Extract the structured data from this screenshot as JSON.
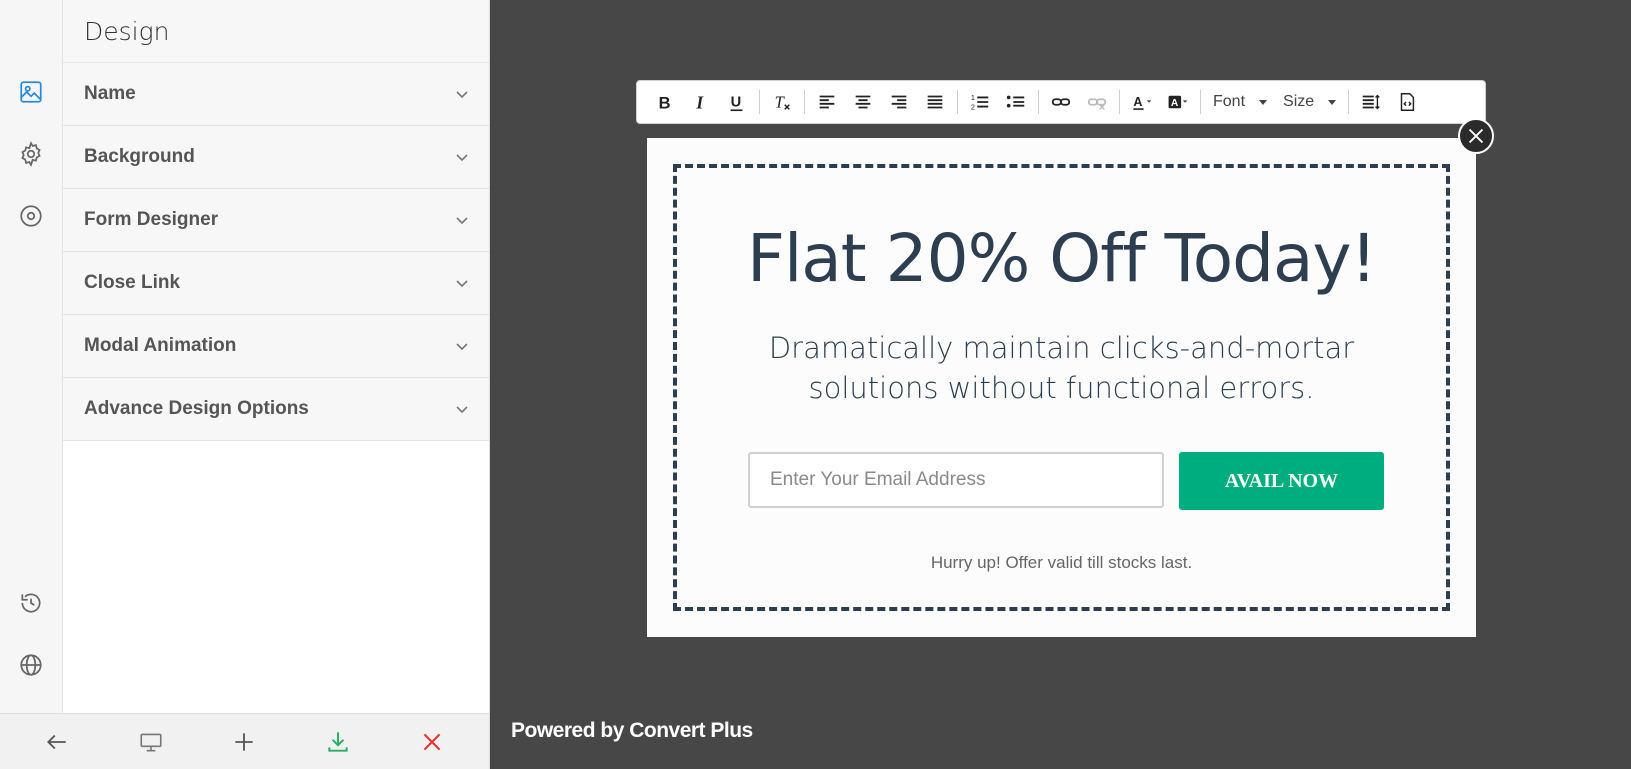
{
  "panel": {
    "title": "Design",
    "sections": [
      {
        "label": "Name"
      },
      {
        "label": "Background"
      },
      {
        "label": "Form Designer"
      },
      {
        "label": "Close Link"
      },
      {
        "label": "Modal Animation"
      },
      {
        "label": "Advance Design Options"
      }
    ]
  },
  "rail": {
    "icons": [
      "image-icon",
      "gear-icon",
      "target-icon",
      "history-icon",
      "globe-icon"
    ],
    "active_color": "#2b8ad8"
  },
  "bottombar": {
    "icons": [
      "back-arrow-icon",
      "desktop-preview-icon",
      "plus-icon",
      "download-icon",
      "close-icon"
    ],
    "save_color": "#27ae60",
    "close_color": "#e53935"
  },
  "toolbar": {
    "font_label": "Font",
    "size_label": "Size"
  },
  "modal": {
    "headline": "Flat 20% Off Today!",
    "subline": "Dramatically maintain clicks-and-mortar solutions without functional errors.",
    "email_placeholder": "Enter Your Email Address",
    "button_label": "AVAIL NOW",
    "note": "Hurry up! Offer valid till stocks last.",
    "accent_color": "#00ad7f",
    "text_color": "#2c3e50"
  },
  "footer": {
    "powered_by": "Powered by Convert Plus"
  }
}
